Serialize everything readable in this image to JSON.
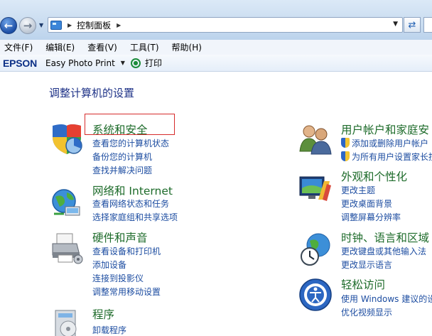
{
  "address_bar": {
    "path": "控制面板"
  },
  "menu": [
    {
      "label": "文件(F)"
    },
    {
      "label": "编辑(E)"
    },
    {
      "label": "查看(V)"
    },
    {
      "label": "工具(T)"
    },
    {
      "label": "帮助(H)"
    }
  ],
  "toolbar": {
    "brand": "EPSON",
    "app": "Easy Photo Print",
    "print": "打印"
  },
  "main": {
    "title": "调整计算机的设置",
    "left": [
      {
        "title": "系统和安全",
        "links": [
          "查看您的计算机状态",
          "备份您的计算机",
          "查找并解决问题"
        ]
      },
      {
        "title": "网络和 Internet",
        "links": [
          "查看网络状态和任务",
          "选择家庭组和共享选项"
        ]
      },
      {
        "title": "硬件和声音",
        "links": [
          "查看设备和打印机",
          "添加设备",
          "连接到投影仪",
          "调整常用移动设置"
        ]
      },
      {
        "title": "程序",
        "links": [
          "卸载程序"
        ]
      }
    ],
    "right": [
      {
        "title": "用户帐户和家庭安",
        "links": [
          "添加或删除用户帐户",
          "为所有用户设置家长控"
        ]
      },
      {
        "title": "外观和个性化",
        "links": [
          "更改主题",
          "更改桌面背景",
          "调整屏幕分辨率"
        ]
      },
      {
        "title": "时钟、语言和区域",
        "links": [
          "更改键盘或其他输入法",
          "更改显示语言"
        ]
      },
      {
        "title": "轻松访问",
        "links": [
          "使用 Windows 建议的设",
          "优化视频显示"
        ]
      }
    ]
  },
  "colors": {
    "category_title": "#1d6b2a",
    "link": "#1d4da1",
    "page_title": "#1e3287",
    "highlight_box": "#d62b2b"
  }
}
